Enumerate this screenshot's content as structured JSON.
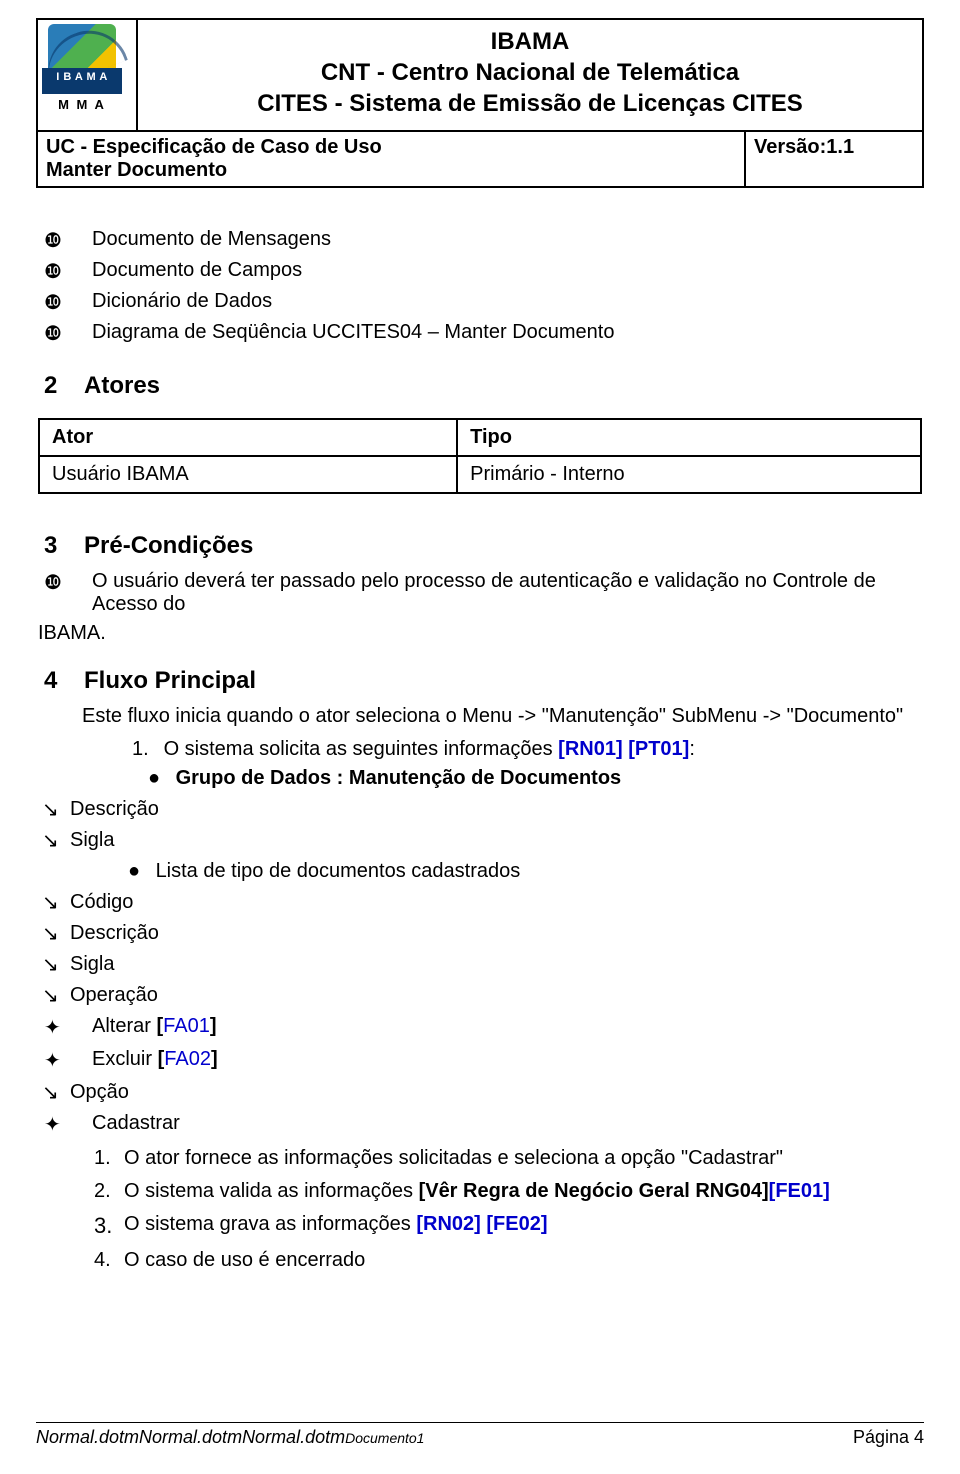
{
  "logo": {
    "line1": "I B A M A",
    "mma": "M M A"
  },
  "header": {
    "org": "IBAMA",
    "dept": "CNT - Centro Nacional de Telemática",
    "system": "CITES - Sistema de Emissão de Licenças CITES",
    "uc_line1": "UC - Especificação de Caso de Uso",
    "uc_line2": "Manter Documento",
    "version": "Versão:1.1"
  },
  "bullets_top": {
    "b1": "Documento de Mensagens",
    "b2": "Documento de Campos",
    "b3": "Dicionário de Dados",
    "b4": "Diagrama de Seqüência UCCITES04 – Manter Documento"
  },
  "sec2": {
    "num": "2",
    "title": "Atores"
  },
  "actor_table": {
    "h1": "Ator",
    "h2": "Tipo",
    "r1c1": "Usuário IBAMA",
    "r1c2": "Primário - Interno"
  },
  "sec3": {
    "num": "3",
    "title": "Pré-Condições",
    "b1a": "O usuário deverá ter passado pelo processo de autenticação e validação no Controle de Acesso do",
    "b1b": "IBAMA."
  },
  "sec4": {
    "num": "4",
    "title": "Fluxo Principal",
    "intro": "Este fluxo inicia quando o ator seleciona o Menu -> \"Manutenção\" SubMenu -> \"Documento\"",
    "s1_n": "1.",
    "s1_text": "O sistema solicita as seguintes informações ",
    "s1_ref1": "[RN01]",
    "s1_ref2": "[PT01]",
    "s1_colon": ":",
    "group_lead": "Grupo de Dados  :",
    "group_name": " Manutenção de Documentos",
    "arrows1": {
      "a1": "Descrição",
      "a2": "Sigla"
    },
    "list_line": "Lista de tipo de documentos cadastrados",
    "arrows2": {
      "a1": "Código",
      "a2": "Descrição",
      "a3": "Sigla",
      "a4": "Operação"
    },
    "cross1_text": "Alterar ",
    "cross1_ref": "[FA01]",
    "cross2_text": "Excluir ",
    "cross2_ref": "[FA02]",
    "arrow_opcao": "Opção",
    "cross3_text": "Cadastrar",
    "steps": {
      "n1": "1.",
      "t1": "O ator fornece as informações solicitadas e seleciona a opção \"Cadastrar\"",
      "n2": "2.",
      "t2a": "O sistema valida as informações ",
      "t2b": "[Vêr Regra de Negócio Geral RNG04]",
      "t2c": "[FE01]",
      "n3": "3.",
      "t3a": "O sistema grava as informações ",
      "t3b": "[RN02]",
      "t3c": " ",
      "t3d": "[FE02]",
      "n4": "4.",
      "t4": " O caso de uso é encerrado"
    }
  },
  "footer": {
    "tpl": "Normal.dotm",
    "doc": "Documento1",
    "page": "Página 4"
  },
  "glyph": {
    "circled10": "❿",
    "arrow_dr": "↘",
    "cross": "✦",
    "dot": "●"
  }
}
